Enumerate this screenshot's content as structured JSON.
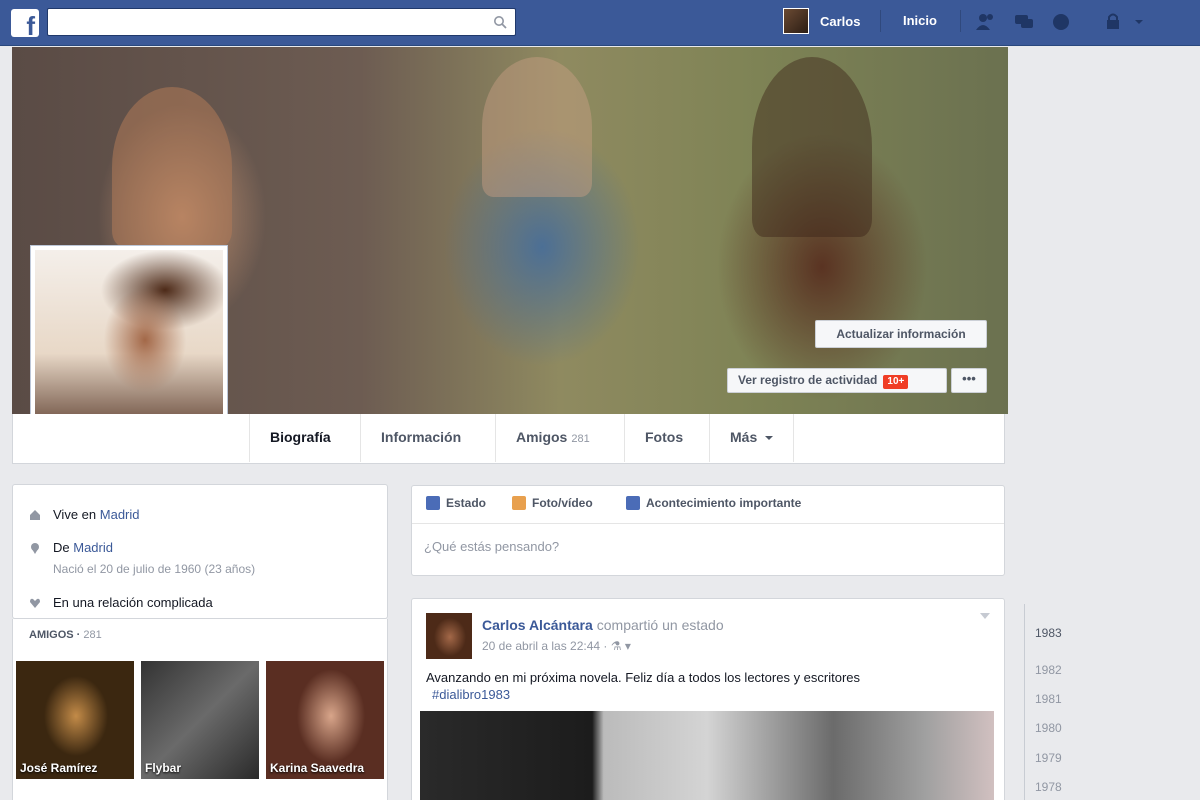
{
  "topbar": {
    "search_placeholder": "",
    "user_name": "Carlos",
    "home_label": "Inicio"
  },
  "cover": {
    "update_info_label": "Actualizar información",
    "activity_log_label": "Ver registro de actividad",
    "activity_badge": "10+",
    "more_label": "•••"
  },
  "tabs": [
    {
      "label": "Biografía"
    },
    {
      "label": "Información"
    },
    {
      "label": "Amigos",
      "count": "281"
    },
    {
      "label": "Fotos"
    },
    {
      "label": "Más"
    }
  ],
  "about": {
    "lives_prefix": "Vive en",
    "lives_city": "Madrid",
    "from_prefix": "De",
    "from_city": "Madrid",
    "born": "Nació el 20 de julio de 1960 (23 años)",
    "relationship": "En una relación complicada"
  },
  "friends": {
    "header": "AMIGOS",
    "count": "281",
    "tiles": [
      {
        "name": "José Ramírez"
      },
      {
        "name": "Flybar"
      },
      {
        "name": "Karina Saavedra"
      }
    ]
  },
  "composer": {
    "tabs": [
      "Estado",
      "Foto/vídeo",
      "Acontecimiento importante"
    ],
    "placeholder": "¿Qué estás pensando?"
  },
  "post": {
    "author": "Carlos Alcántara",
    "action": "compartió un estado",
    "meta": "20 de abril a las 22:44 · ⚗ ▾",
    "text": "Avanzando en mi próxima novela. Feliz día a todos los lectores y escritores",
    "hashtag": "#dialibro1983"
  },
  "timeline": {
    "years": [
      "1983",
      "1982",
      "1981",
      "1980",
      "1979",
      "1978"
    ]
  },
  "colors": {
    "brand_blue": "#3b5998",
    "page_bg": "#e9eaed",
    "badge_red": "#f03d25"
  }
}
